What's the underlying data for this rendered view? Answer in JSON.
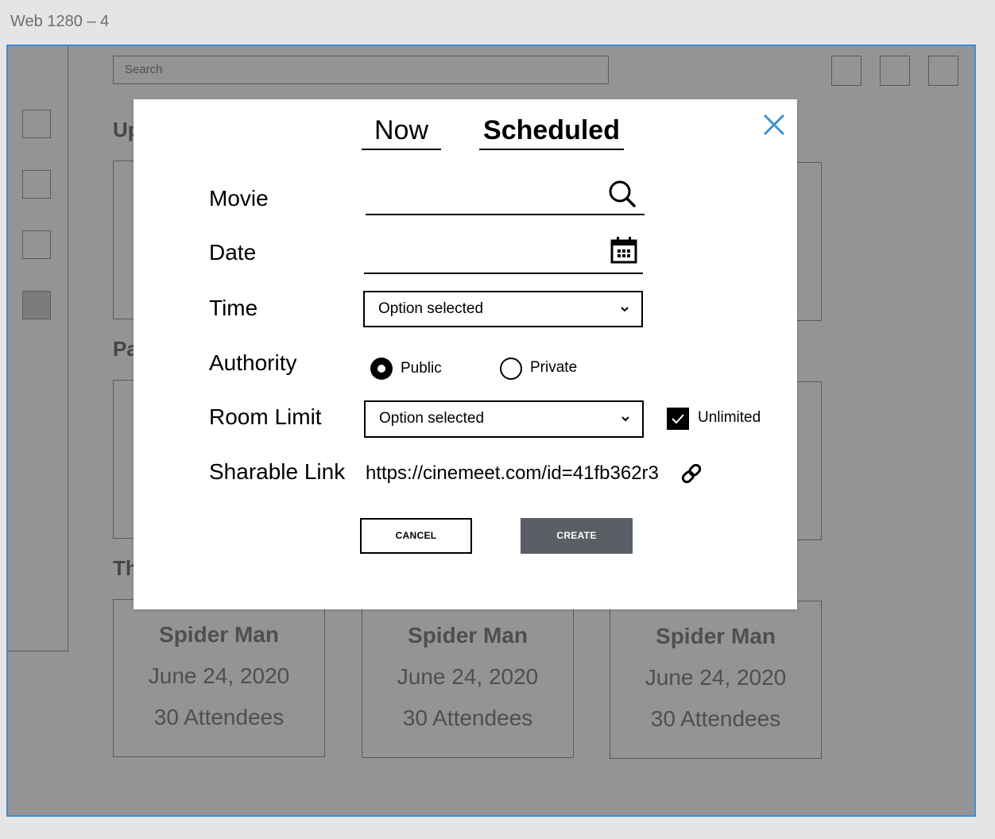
{
  "frame_label": "Web 1280 – 4",
  "background": {
    "search_placeholder": "Search",
    "headings": [
      "Up",
      "Pa",
      "Th"
    ],
    "cards": [
      {
        "title": "Spider Man",
        "date": "June 24, 2020",
        "attendees": "30 Attendees"
      },
      {
        "title": "Spider Man",
        "date": "June 24, 2020",
        "attendees": "30 Attendees"
      },
      {
        "title": "Spider Man",
        "date": "June 24, 2020",
        "attendees": "30 Attendees"
      }
    ]
  },
  "modal": {
    "tabs": {
      "now": "Now",
      "scheduled": "Scheduled",
      "active": "scheduled"
    },
    "labels": {
      "movie": "Movie",
      "date": "Date",
      "time": "Time",
      "authority": "Authority",
      "room_limit": "Room Limit",
      "sharable_link": "Sharable Link"
    },
    "movie_value": "",
    "date_value": "",
    "time_select": "Option selected",
    "authority": {
      "public": "Public",
      "private": "Private",
      "selected": "public"
    },
    "room_limit_select": "Option selected",
    "unlimited_label": "Unlimited",
    "unlimited_checked": true,
    "link": "https://cinemeet.com/id=41fb362r3",
    "buttons": {
      "cancel": "CANCEL",
      "create": "CREATE"
    }
  },
  "icons": [
    "close-icon",
    "search-icon",
    "calendar-icon",
    "chevron-down-icon",
    "link-icon",
    "checkmark-icon"
  ],
  "colors": {
    "close_icon": "#3d8fd6",
    "create_button": "#5a5f66",
    "overlay": "rgba(0,0,0,0.42)",
    "frame_border": "#3d8fd6"
  }
}
